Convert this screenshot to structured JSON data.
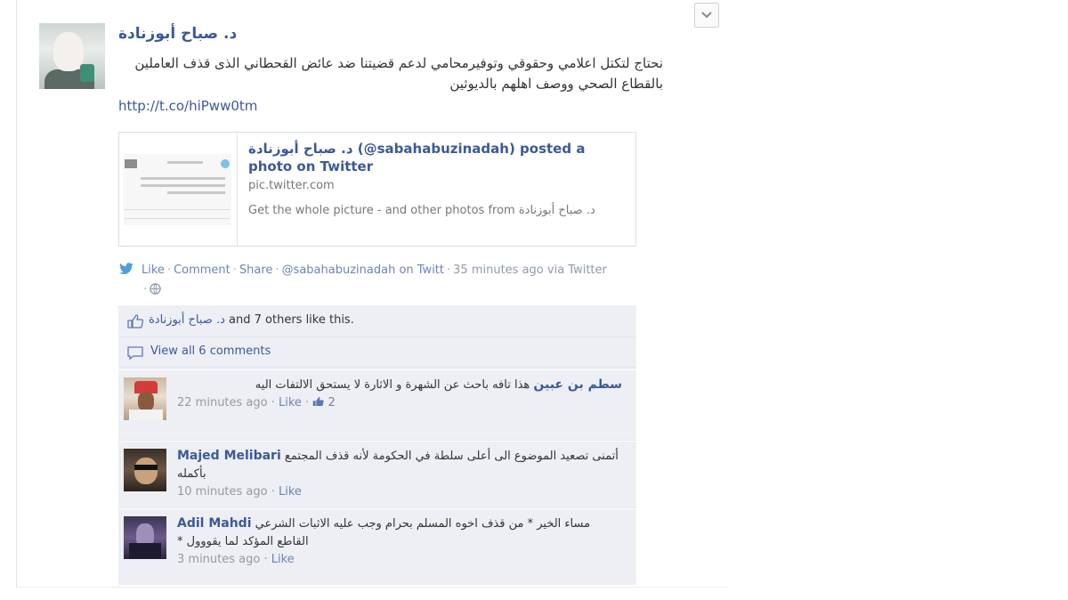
{
  "post": {
    "author": "د. صباح أبوزنادة",
    "text": "نحتاج لتكتل اعلامي وحقوقي وتوفيرمحامي لدعم قضيتنا ضد عائض القحطاني الذى قذف العاملين بالقطاع الصحي ووصف اهلهم بالديوثين",
    "link": "http://t.co/hiPww0tm"
  },
  "share": {
    "title": "د. صباح أبوزنادة (@sabahabuzinadah) posted a photo on Twitter",
    "domain": "pic.twitter.com",
    "description": "Get the whole picture - and other photos from د. صباح أبوزنادة"
  },
  "actions": {
    "like": "Like",
    "comment": "Comment",
    "share": "Share",
    "twitter_handle": "@sabahabuzinadah on Twitt",
    "time": "35 minutes ago via Twitter"
  },
  "likes": {
    "name": "د. صباح أبوزنادة",
    "rest": " and 7 others like this."
  },
  "view_all": "View all 6 comments",
  "comments": [
    {
      "name": "سطم بن عبين",
      "text": "هذا تافه باحث عن الشهرة و الاثارة لا يستحق الالتفات اليه",
      "time": "22 minutes ago",
      "like": "Like",
      "likes_count": "2"
    },
    {
      "name": "Majed Melibari",
      "text": "أتمنى تصعيد الموضوع الى أعلى سلطة في الحكومة لأنه قذف المجتمع بأكمله",
      "time": "10 minutes ago",
      "like": "Like",
      "likes_count": ""
    },
    {
      "name": "Adil Mahdi",
      "text": "مساء الخير * من قذف اخوه المسلم بحرام وجب عليه الاثبات الشرعي القاطع المؤكد لما يقووول *",
      "time": "3 minutes ago",
      "like": "Like",
      "likes_count": ""
    }
  ],
  "colors": {
    "link": "#3b5998",
    "ufi_bg": "#edeff4",
    "meta": "#999999"
  }
}
